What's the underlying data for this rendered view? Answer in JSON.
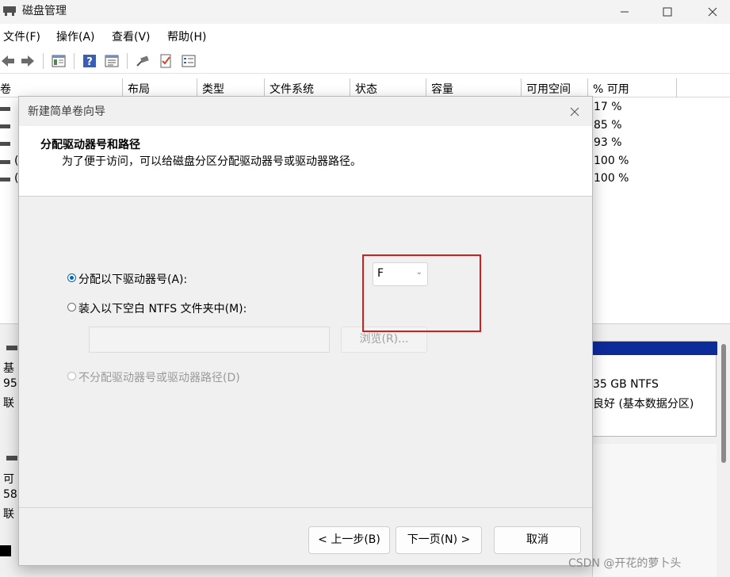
{
  "window": {
    "title": "磁盘管理"
  },
  "menu": [
    "文件(F)",
    "操作(A)",
    "查看(V)",
    "帮助(H)"
  ],
  "toolbar_icons": [
    "back-arrow-icon",
    "forward-arrow-icon",
    "console-tree-icon",
    "help-icon",
    "properties-icon",
    "connect-disk-icon",
    "check-icon",
    "settings-list-icon"
  ],
  "volume_list": {
    "columns": [
      "卷",
      "布局",
      "类型",
      "文件系统",
      "状态",
      "容量",
      "可用空间",
      "% 可用"
    ],
    "pct_free": [
      "17 %",
      "85 %",
      "93 %",
      "100 %",
      "100 %"
    ],
    "row_fragments": [
      "",
      "",
      "",
      "(",
      "("
    ]
  },
  "disk_pane": {
    "disk0_info": [
      "基",
      "95",
      "联"
    ],
    "disk1_info": [
      "可",
      "58",
      "联"
    ],
    "partition": {
      "size": "35 GB NTFS",
      "status": "良好 (基本数据分区)"
    }
  },
  "wizard": {
    "title": "新建简单卷向导",
    "heading": "分配驱动器号和路径",
    "description": "为了便于访问，可以给磁盘分区分配驱动器号或驱动器路径。",
    "options": {
      "assign_letter": "分配以下驱动器号(A):",
      "mount_folder": "装入以下空白 NTFS 文件夹中(M):",
      "no_assign": "不分配驱动器号或驱动器路径(D)"
    },
    "drive_letter": "F",
    "folder_path": "",
    "browse_label": "浏览(R)...",
    "buttons": {
      "back": "< 上一步(B)",
      "next": "下一页(N) >",
      "cancel": "取消"
    }
  },
  "watermark": "CSDN @开花的萝卜头",
  "colors": {
    "accent": "#0067c0",
    "highlight_box": "#d61d1d",
    "partition_bar": "#0d2c9b"
  }
}
